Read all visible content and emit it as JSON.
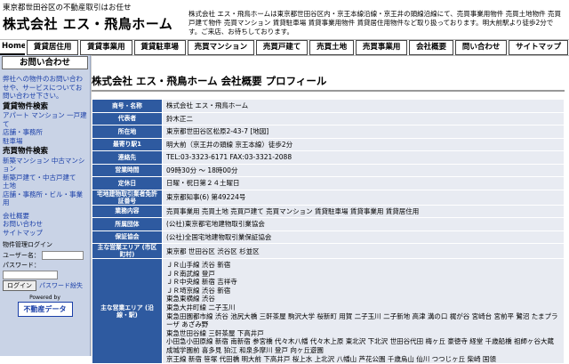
{
  "header": {
    "tagline": "東京都世田谷区の不動産取引はお任せ",
    "company": "株式会社 エス・飛鳥ホーム",
    "intro": "株式会社 エス・飛鳥ホームは東京都世田谷区内・京王本線沿線・京王井の頭線沿線にて、売買事業用物件 売買土地物件 売買戸建て物件 売買マンション 賃貸駐車場 賃貸事業用物件 賃貸居住用物件など取り扱っております。明大前駅より徒歩2分です。ご来店、お待ちしております。"
  },
  "nav": [
    "Home",
    "賃貸居住用",
    "賃貸事業用",
    "賃貸駐車場",
    "売買マンション",
    "売買戸建て",
    "売買土地",
    "売買事業用",
    "会社概要",
    "問い合わせ",
    "サイトマップ"
  ],
  "sidebar": {
    "contact_heading": "お問い合わせ",
    "contact_text": "弊社への物件のお問い合わせや、サービスについてお問い合わせ下さい。",
    "rental_heading": "賃貸物件検索",
    "rental_links": [
      "アパート マンション 一戸建て",
      "店舗・事務所",
      "駐車場"
    ],
    "sale_heading": "売買物件検索",
    "sale_links": [
      "新築マンション 中古マンション",
      "新築戸建て・中古戸建て",
      "土地",
      "店舗・事務所・ビル・事業用"
    ],
    "misc_links": [
      "会社概要",
      "お問い合わせ",
      "サイトマップ"
    ],
    "login_title": "物件管理ログイン",
    "user_label": "ユーザー名：",
    "pass_label": "パスワード：",
    "login_button": "ログイン",
    "forgot_link": "パスワード紛失",
    "powered_by": "Powered by",
    "logo_text": "不動産データ"
  },
  "main": {
    "title": "株式会社 エス・飛鳥ホーム 会社概要 プロフィール",
    "rows": [
      {
        "k": "商号・名称",
        "v": "株式会社 エス・飛鳥ホーム"
      },
      {
        "k": "代表者",
        "v": "鈴木正二"
      },
      {
        "k": "所在地",
        "v": "東京都世田谷区松原2-43-7 [地図]"
      },
      {
        "k": "最寄り駅1",
        "v": "明大前（京王井の頭線 京王本線）徒歩2分"
      },
      {
        "k": "連絡先",
        "v": "TEL:03-3323-6171 FAX:03-3321-2088"
      },
      {
        "k": "営業時間",
        "v": "09時30分 ～ 18時00分"
      },
      {
        "k": "定休日",
        "v": "日曜・祝日第２４土曜日"
      },
      {
        "k": "宅地建物取引業者免許証番号",
        "v": "東京都知事(6) 第49224号"
      },
      {
        "k": "業務内容",
        "v": "売買事業用 売買土地 売買戸建て 売買マンション 賃貸駐車場 賃貸事業用 賃貸居住用"
      },
      {
        "k": "所属団体",
        "v": "(公社)東京都宅地建物取引業協会"
      },
      {
        "k": "保証協会",
        "v": "(公社)全国宅地建物取引業保証協会"
      },
      {
        "k": "主な営業エリア (市区町村)",
        "v": "東京都 世田谷区 渋谷区 杉並区"
      }
    ],
    "lines_key": "主な営業エリア (沿線・駅)",
    "lines": [
      "ＪＲ山手線 渋谷 新宿",
      "ＪＲ南武線 登戸",
      "ＪＲ中央線 新宿 吉祥寺",
      "ＪＲ埼京線 渋谷 新宿",
      "東急東横線 渋谷",
      "東急大井町線 二子玉川",
      "東急田園都市線 渋谷 池尻大橋 三軒茶屋 駒沢大学 桜新町 用賀 二子玉川 二子新地 高津 溝の口 梶が谷 宮崎台 宮前平 鷺沼 たまプラーザ あざみ野",
      "東急世田谷線 三軒茶屋 下高井戸",
      "小田急小田原線 新宿 南新宿 参宮橋 代々木八幡 代々木上原 東北沢 下北沢 世田谷代田 梅ヶ丘 豪徳寺 経堂 千歳船橋 祖師ヶ谷大蔵 成城学園前 喜多見 狛江 和泉多摩川 登戸 向ヶ丘遊園",
      "京王線 新宿 笹塚 代田橋 明大前 下高井戸 桜上水 上北沢 八幡山 芦花公園 千歳烏山 仙川 つつじヶ丘 柴崎 国領"
    ]
  }
}
